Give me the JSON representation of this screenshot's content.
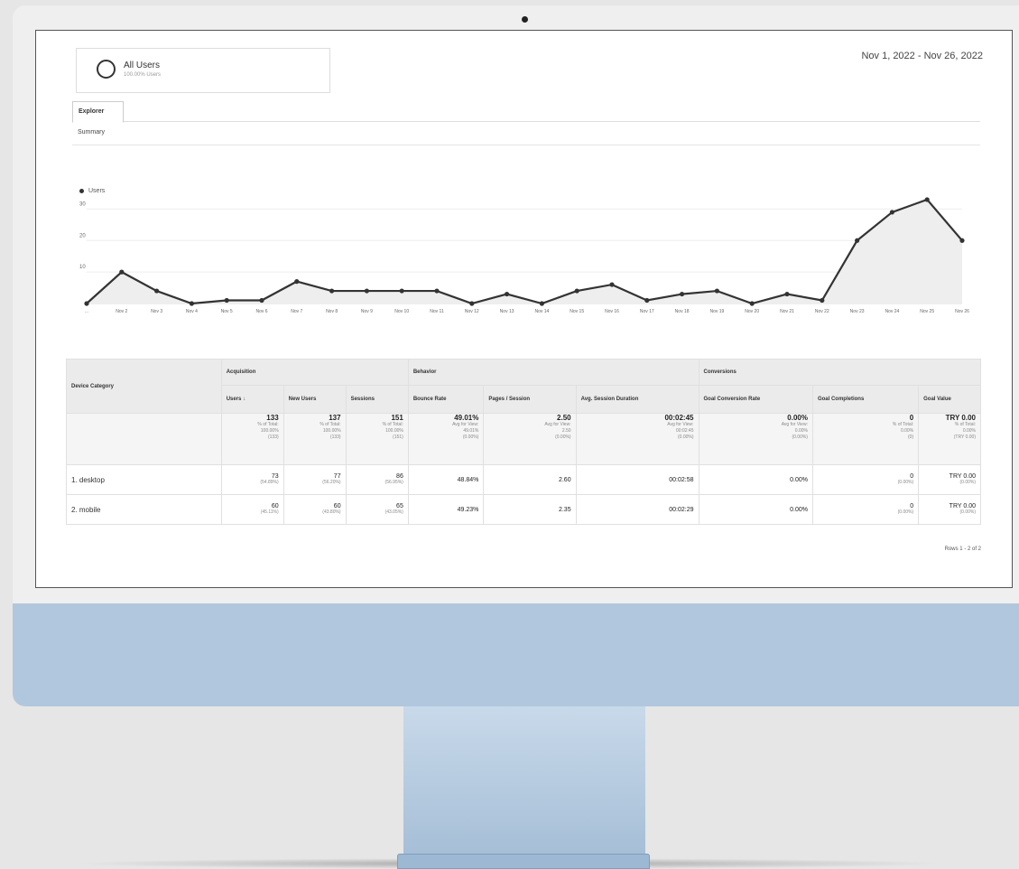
{
  "segment": {
    "title": "All Users",
    "subtitle": "100.00% Users"
  },
  "date_range": "Nov 1, 2022 - Nov 26, 2022",
  "tabs": {
    "explorer": "Explorer",
    "summary": "Summary"
  },
  "chart_data": {
    "type": "line",
    "legend": "Users",
    "x": [
      "...",
      "Nov 2",
      "Nov 3",
      "Nov 4",
      "Nov 5",
      "Nov 6",
      "Nov 7",
      "Nov 8",
      "Nov 9",
      "Nov 10",
      "Nov 11",
      "Nov 12",
      "Nov 13",
      "Nov 14",
      "Nov 15",
      "Nov 16",
      "Nov 17",
      "Nov 18",
      "Nov 19",
      "Nov 20",
      "Nov 21",
      "Nov 22",
      "Nov 23",
      "Nov 24",
      "Nov 25",
      "Nov 26"
    ],
    "values": [
      0,
      10,
      4,
      0,
      1,
      1,
      7,
      4,
      4,
      4,
      4,
      0,
      3,
      0,
      4,
      6,
      1,
      3,
      4,
      0,
      3,
      1,
      20,
      29,
      33,
      20
    ],
    "yticks": [
      10,
      20,
      30
    ],
    "ylim": [
      0,
      35
    ],
    "series_color": "#333333",
    "fill_color": "#eeeeee"
  },
  "table": {
    "groups": {
      "dimension": "Device Category",
      "acquisition": "Acquisition",
      "behavior": "Behavior",
      "conversions": "Conversions"
    },
    "columns": [
      "Users",
      "New Users",
      "Sessions",
      "Bounce Rate",
      "Pages / Session",
      "Avg. Session Duration",
      "Goal Conversion Rate",
      "Goal Completions",
      "Goal Value"
    ],
    "sort_icon": "arrow-down-icon",
    "totals": [
      {
        "value": "133",
        "sub1": "% of Total:",
        "sub2": "100.00%",
        "sub3": "(133)"
      },
      {
        "value": "137",
        "sub1": "% of Total:",
        "sub2": "100.00%",
        "sub3": "(133)"
      },
      {
        "value": "151",
        "sub1": "% of Total:",
        "sub2": "100.00%",
        "sub3": "(151)"
      },
      {
        "value": "49.01%",
        "sub1": "Avg for View:",
        "sub2": "49.01%",
        "sub3": "(0.00%)"
      },
      {
        "value": "2.50",
        "sub1": "Avg for View:",
        "sub2": "2.50",
        "sub3": "(0.00%)"
      },
      {
        "value": "00:02:45",
        "sub1": "Avg for View:",
        "sub2": "00:02:45",
        "sub3": "(0.00%)"
      },
      {
        "value": "0.00%",
        "sub1": "Avg for View:",
        "sub2": "0.00%",
        "sub3": "(0.00%)"
      },
      {
        "value": "0",
        "sub1": "% of Total:",
        "sub2": "0.00%",
        "sub3": "(0)"
      },
      {
        "value": "TRY 0.00",
        "sub1": "% of Total:",
        "sub2": "0.00%",
        "sub3": "(TRY 0.00)"
      }
    ],
    "rows": [
      {
        "label": "1.  desktop",
        "cells": [
          {
            "value": "73",
            "sub": "(54.89%)"
          },
          {
            "value": "77",
            "sub": "(56.20%)"
          },
          {
            "value": "86",
            "sub": "(56.95%)"
          },
          {
            "value": "48.84%",
            "sub": ""
          },
          {
            "value": "2.60",
            "sub": ""
          },
          {
            "value": "00:02:58",
            "sub": ""
          },
          {
            "value": "0.00%",
            "sub": ""
          },
          {
            "value": "0",
            "sub": "(0.00%)"
          },
          {
            "value": "TRY 0.00",
            "sub": "(0.00%)"
          }
        ]
      },
      {
        "label": "2.  mobile",
        "cells": [
          {
            "value": "60",
            "sub": "(45.11%)"
          },
          {
            "value": "60",
            "sub": "(43.80%)"
          },
          {
            "value": "65",
            "sub": "(43.05%)"
          },
          {
            "value": "49.23%",
            "sub": ""
          },
          {
            "value": "2.35",
            "sub": ""
          },
          {
            "value": "00:02:29",
            "sub": ""
          },
          {
            "value": "0.00%",
            "sub": ""
          },
          {
            "value": "0",
            "sub": "(0.00%)"
          },
          {
            "value": "TRY 0.00",
            "sub": "(0.00%)"
          }
        ]
      }
    ],
    "pager": "Rows 1 - 2 of 2"
  }
}
